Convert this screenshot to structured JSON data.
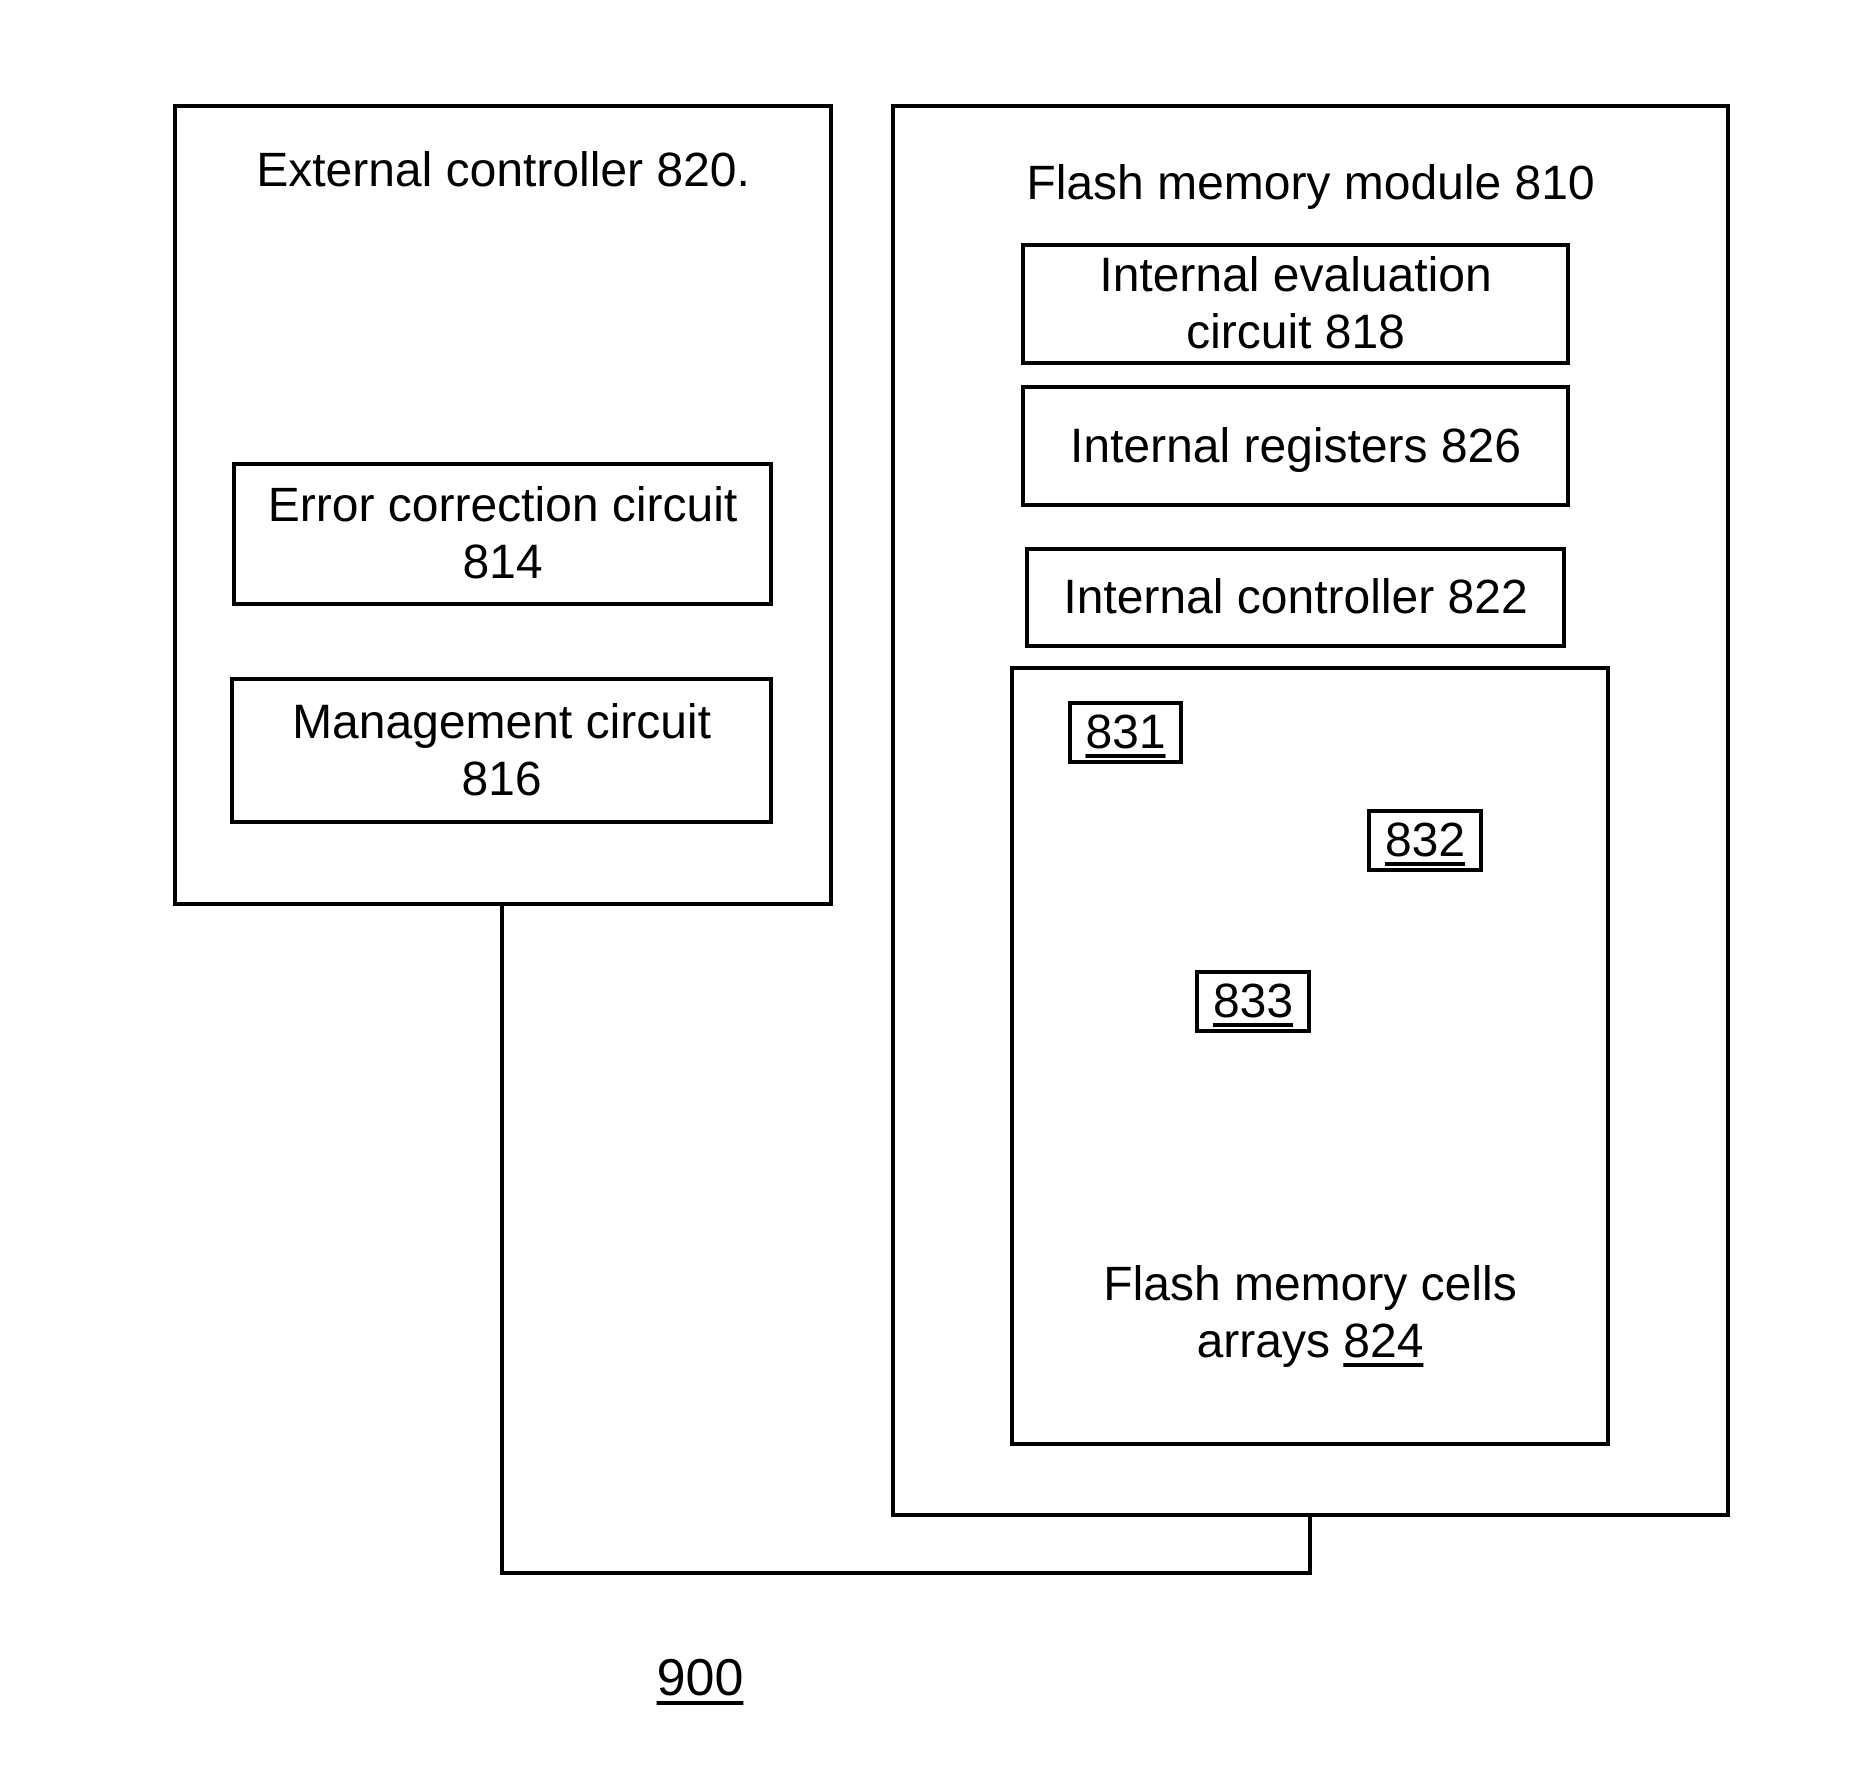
{
  "figure": {
    "reference_label": "900",
    "external_controller": {
      "title": "External controller 820.",
      "error_correction": "Error correction circuit\n814",
      "management": "Management circuit\n816"
    },
    "flash_module": {
      "title": "Flash memory module 810",
      "internal_evaluation": "Internal evaluation\ncircuit 818",
      "internal_registers": "Internal registers 826",
      "internal_controller": "Internal controller 822",
      "cells_arrays": {
        "label_text": "Flash memory cells\narrays ",
        "label_ref": "824",
        "blocks": [
          "831",
          "832",
          "833"
        ]
      }
    }
  }
}
